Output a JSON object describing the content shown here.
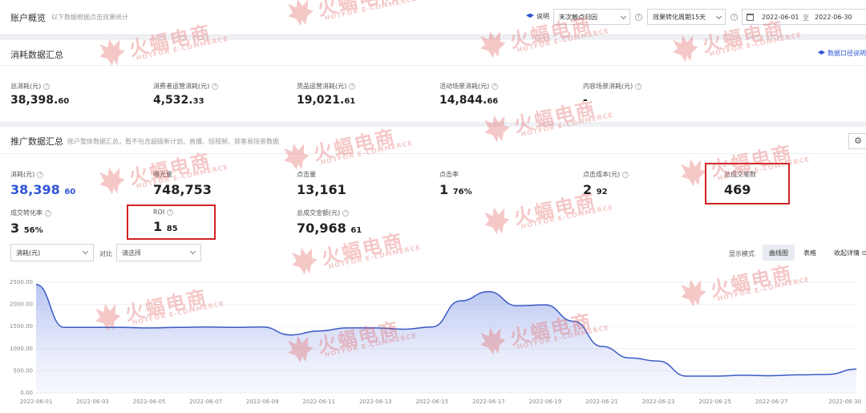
{
  "header": {
    "title": "账户概览",
    "subtitle": "以下数据根据点击效果统计",
    "help_label": "说明",
    "attribution_select": "末次触点归因",
    "conversion_select": "效果转化周期15天",
    "date_start": "2022-06-01",
    "date_sep": "至",
    "date_end": "2022-06-30"
  },
  "spend_summary": {
    "title": "消耗数据汇总",
    "doc_link": "数据口径说明",
    "metrics": [
      {
        "label": "总消耗(元)",
        "int": "38,398.",
        "dec": "60"
      },
      {
        "label": "消费者运营消耗(元)",
        "int": "4,532.",
        "dec": "33"
      },
      {
        "label": "货品运营消耗(元)",
        "int": "19,021.",
        "dec": "61"
      },
      {
        "label": "活动场景消耗(元)",
        "int": "14,844.",
        "dec": "66"
      },
      {
        "label": "内容场景消耗(元)",
        "int": "-",
        "dec": ""
      }
    ]
  },
  "promo_summary": {
    "title": "推广数据汇总",
    "subtitle": "账户整体数据汇总，暂不包含超级新计划、直播、短视频、获客易场景数据",
    "settings_icon": "gear-icon",
    "metrics": [
      {
        "label": "消耗(元)",
        "int": "38,398",
        "dec": "60"
      },
      {
        "label": "曝光量",
        "int": "748,753",
        "dec": ""
      },
      {
        "label": "点击量",
        "int": "13,161",
        "dec": ""
      },
      {
        "label": "点击率",
        "int": "1",
        "dec": "76%"
      },
      {
        "label": "点击成本(元)",
        "int": "2",
        "dec": "92"
      },
      {
        "label": "总成交笔数",
        "int": "469",
        "dec": ""
      },
      {
        "label": "成交转化率",
        "int": "3",
        "dec": "56%"
      },
      {
        "label": "ROI",
        "int": "1",
        "dec": "85"
      },
      {
        "label": "总成交金额(元)",
        "int": "70,968",
        "dec": "61"
      }
    ]
  },
  "chart_controls": {
    "metric_select": "消耗(元)",
    "compare_label": "对比",
    "compare_select": "请选择",
    "mode_label": "显示模式",
    "mode_line": "曲线图",
    "mode_table": "表格",
    "collapse": "收起详情"
  },
  "watermark": {
    "cn": "火蝠电商",
    "en": "HOTFOR E-COMMERCE"
  },
  "colors": {
    "accent": "#2f55d4",
    "line": "#3b5bc6",
    "highlight_box": "#d32222"
  },
  "chart_data": {
    "type": "area",
    "ylim": [
      0,
      2500
    ],
    "yticks": [
      "2500.00",
      "2000.00",
      "1500.00",
      "1000.00",
      "500.00",
      "0.00"
    ],
    "x_tick_labels": [
      "2022-06-01",
      "2022-06-03",
      "2022-06-05",
      "2022-06-07",
      "2022-06-09",
      "2022-06-11",
      "2022-06-13",
      "2022-06-15",
      "2022-06-17",
      "2022-06-19",
      "2022-06-21",
      "2022-06-23",
      "2022-06-25",
      "2022-06-27",
      "2022-06-30"
    ],
    "x": [
      "2022-06-01",
      "2022-06-02",
      "2022-06-03",
      "2022-06-04",
      "2022-06-05",
      "2022-06-06",
      "2022-06-07",
      "2022-06-08",
      "2022-06-09",
      "2022-06-10",
      "2022-06-11",
      "2022-06-12",
      "2022-06-13",
      "2022-06-14",
      "2022-06-15",
      "2022-06-16",
      "2022-06-17",
      "2022-06-18",
      "2022-06-19",
      "2022-06-20",
      "2022-06-21",
      "2022-06-22",
      "2022-06-23",
      "2022-06-24",
      "2022-06-25",
      "2022-06-26",
      "2022-06-27",
      "2022-06-28",
      "2022-06-29",
      "2022-06-30"
    ],
    "values": [
      2450,
      1480,
      1480,
      1480,
      1470,
      1480,
      1490,
      1480,
      1490,
      1310,
      1400,
      1470,
      1470,
      1440,
      1490,
      2080,
      2290,
      1970,
      1990,
      1620,
      1050,
      790,
      720,
      380,
      380,
      400,
      390,
      410,
      420,
      540
    ]
  }
}
